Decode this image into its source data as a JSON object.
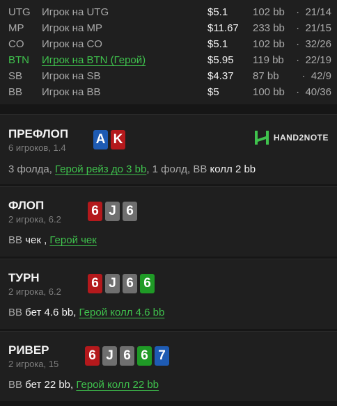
{
  "players": [
    {
      "pos": "UTG",
      "name": "Игрок на UTG",
      "stack": "$5.1",
      "bb": "102 bb",
      "stat": "21/14",
      "hero": false
    },
    {
      "pos": "MP",
      "name": "Игрок на MP",
      "stack": "$11.67",
      "bb": "233 bb",
      "stat": "21/15",
      "hero": false
    },
    {
      "pos": "CO",
      "name": "Игрок на CO",
      "stack": "$5.1",
      "bb": "102 bb",
      "stat": "32/26",
      "hero": false
    },
    {
      "pos": "BTN",
      "name": "Игрок на BTN (Герой)",
      "stack": "$5.95",
      "bb": "119 bb",
      "stat": "22/19",
      "hero": true
    },
    {
      "pos": "SB",
      "name": "Игрок на SB",
      "stack": "$4.37",
      "bb": "87 bb",
      "stat": "42/9",
      "hero": false
    },
    {
      "pos": "BB",
      "name": "Игрок на BB",
      "stack": "$5",
      "bb": "100 bb",
      "stat": "40/36",
      "hero": false
    }
  ],
  "dot": "·",
  "preflop": {
    "title": "ПРЕФЛОП",
    "sub": "6 игроков, 1.4",
    "cards": [
      {
        "rank": "A",
        "color": "blue"
      },
      {
        "rank": "K",
        "color": "red"
      }
    ],
    "logo": "HAND2NOTE",
    "action": {
      "p1": "3 фолда, ",
      "hero": "Герой рейз до 3 bb",
      "p2": ", 1 фолд, ",
      "bb": "BB",
      "call": " колл 2 bb"
    }
  },
  "flop": {
    "title": "ФЛОП",
    "sub": "2 игрока, 6.2",
    "cards": [
      {
        "rank": "6",
        "color": "red"
      },
      {
        "rank": "J",
        "color": "grey"
      },
      {
        "rank": "6",
        "color": "grey"
      }
    ],
    "action": {
      "bb": "BB",
      "check": " чек",
      "sep": " , ",
      "hero": "Герой чек"
    }
  },
  "turn": {
    "title": "ТУРН",
    "sub": "2 игрока, 6.2",
    "cards": [
      {
        "rank": "6",
        "color": "red"
      },
      {
        "rank": "J",
        "color": "grey"
      },
      {
        "rank": "6",
        "color": "grey"
      },
      {
        "rank": "6",
        "color": "green"
      }
    ],
    "action": {
      "bb": "BB",
      "bet": " бет 4.6 bb",
      "sep": ", ",
      "hero": "Герой колл 4.6 bb"
    }
  },
  "river": {
    "title": "РИВЕР",
    "sub": "2 игрока, 15",
    "cards": [
      {
        "rank": "6",
        "color": "red"
      },
      {
        "rank": "J",
        "color": "grey"
      },
      {
        "rank": "6",
        "color": "grey"
      },
      {
        "rank": "6",
        "color": "green"
      },
      {
        "rank": "7",
        "color": "blue"
      }
    ],
    "action": {
      "bb": "BB",
      "bet": " бет 22 bb",
      "sep": ", ",
      "hero": "Герой колл 22 bb"
    }
  },
  "colors": {
    "hero": "#3fc24d",
    "blue": "#1e5bb3",
    "red": "#b4191c",
    "grey": "#6f6f6f",
    "green": "#1f9a26"
  }
}
